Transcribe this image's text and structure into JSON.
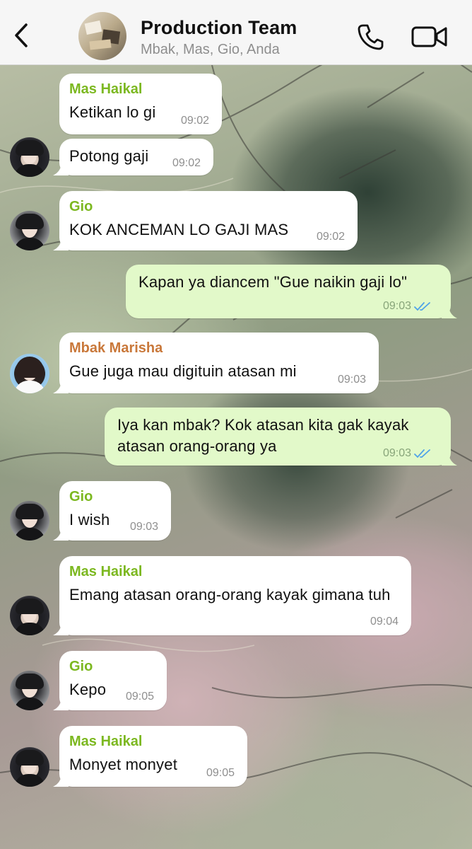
{
  "header": {
    "title": "Production Team",
    "members": "Mbak, Mas, Gio, Anda",
    "back_icon": "chevron-left-icon",
    "call_icon": "phone-icon",
    "video_icon": "video-camera-icon"
  },
  "messages": [
    {
      "direction": "in",
      "sender": "Mas Haikal",
      "text": "Ketikan lo gi",
      "time": "09:02"
    },
    {
      "direction": "in",
      "sender": "",
      "text": "Potong gaji",
      "time": "09:02"
    },
    {
      "direction": "in",
      "sender": "Gio",
      "text": "KOK ANCEMAN LO GAJI MAS",
      "time": "09:02"
    },
    {
      "direction": "out",
      "sender": "",
      "text": "Kapan ya diancem \"Gue naikin gaji lo\"",
      "time": "09:03",
      "status": "read"
    },
    {
      "direction": "in",
      "sender": "Mbak Marisha",
      "text": "Gue juga mau digituin atasan mi",
      "time": "09:03"
    },
    {
      "direction": "out",
      "sender": "",
      "text": "Iya kan mbak? Kok atasan kita gak kayak atasan orang-orang ya",
      "time": "09:03",
      "status": "read"
    },
    {
      "direction": "in",
      "sender": "Gio",
      "text": "I wish",
      "time": "09:03"
    },
    {
      "direction": "in",
      "sender": "Mas Haikal",
      "text": "Emang atasan orang-orang kayak gimana tuh",
      "time": "09:04"
    },
    {
      "direction": "in",
      "sender": "Gio",
      "text": "Kepo",
      "time": "09:05"
    },
    {
      "direction": "in",
      "sender": "Mas Haikal",
      "text": "Monyet monyet",
      "time": "09:05"
    }
  ],
  "colors": {
    "incoming_bubble": "#ffffff",
    "outgoing_bubble": "#e2f9c9",
    "sender_green": "#7cb820",
    "sender_orange": "#c9783a",
    "read_ticks": "#4fa3e8",
    "header_bg": "#f6f6f6"
  }
}
